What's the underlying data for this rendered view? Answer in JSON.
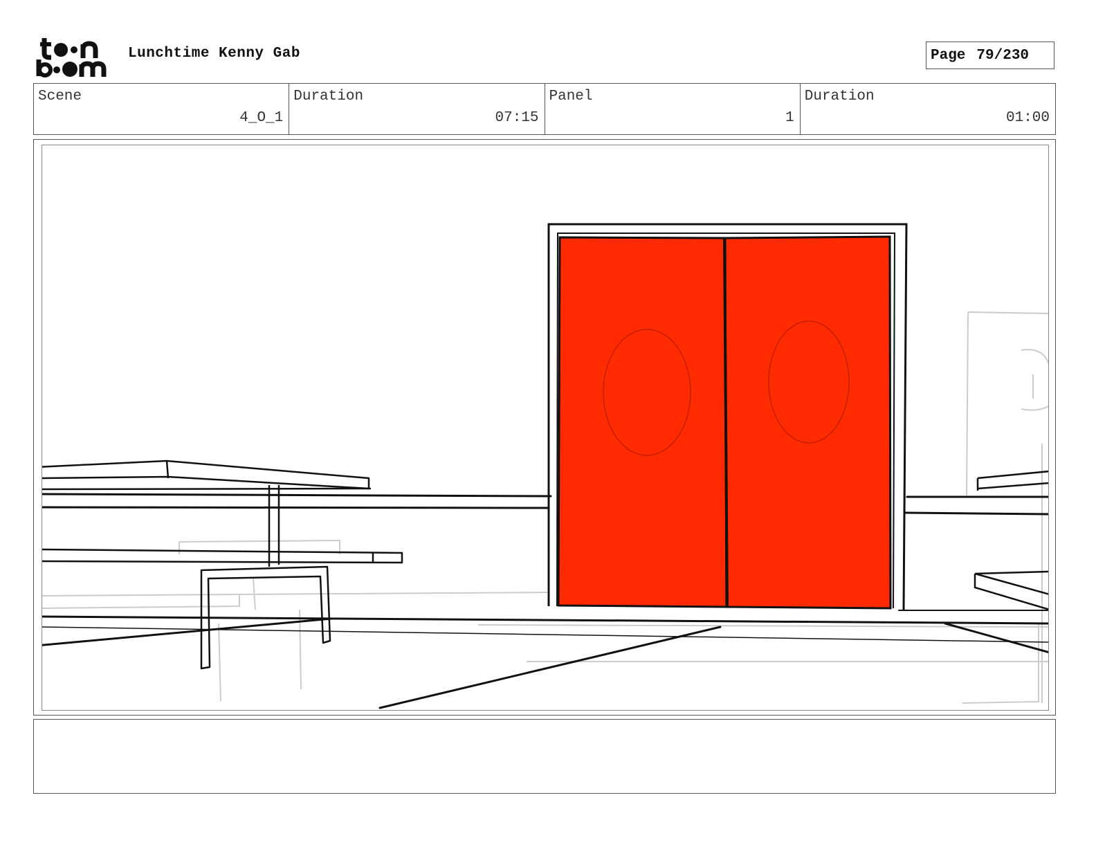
{
  "header": {
    "logo_text": "toon boom",
    "project_title": "Lunchtime Kenny Gab",
    "page_label": "Page",
    "page_value": "79/230"
  },
  "info": {
    "scene_label": "Scene",
    "scene_value": "4_O_1",
    "scene_duration_label": "Duration",
    "scene_duration_value": "07:15",
    "panel_label": "Panel",
    "panel_value": "1",
    "panel_duration_label": "Duration",
    "panel_duration_value": "01:00"
  },
  "colors": {
    "door_fill": "#ff2a00",
    "ink": "#111111",
    "sketch": "#cccccc"
  }
}
